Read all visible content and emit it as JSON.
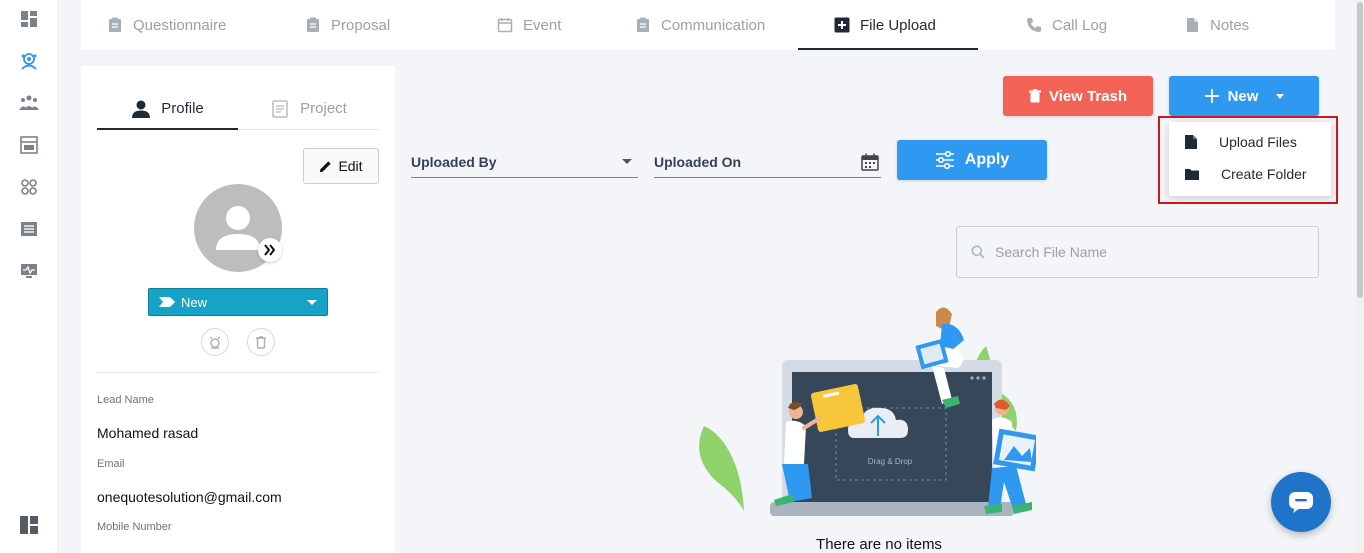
{
  "top_tabs": [
    {
      "label": "Questionnaire",
      "icon": "clipboard-icon",
      "active": false
    },
    {
      "label": "Proposal",
      "icon": "clipboard-icon",
      "active": false
    },
    {
      "label": "Event",
      "icon": "calendar-icon",
      "active": false
    },
    {
      "label": "Communication",
      "icon": "clipboard-icon",
      "active": false
    },
    {
      "label": "File Upload",
      "icon": "plus-square-icon",
      "active": true
    },
    {
      "label": "Call Log",
      "icon": "phone-icon",
      "active": false
    },
    {
      "label": "Notes",
      "icon": "file-icon",
      "active": false
    }
  ],
  "profile": {
    "tabs": [
      {
        "label": "Profile",
        "icon": "person-icon",
        "active": true
      },
      {
        "label": "Project",
        "icon": "project-icon",
        "active": false
      }
    ],
    "edit_label": "Edit",
    "status_value": "New",
    "fields": [
      {
        "label": "Lead Name",
        "value": "Mohamed rasad"
      },
      {
        "label": "Email",
        "value": "onequotesolution@gmail.com"
      },
      {
        "label": "Mobile Number",
        "value": ""
      }
    ]
  },
  "toolbar": {
    "view_trash_label": "View Trash",
    "new_label": "New",
    "apply_label": "Apply"
  },
  "filters": {
    "uploaded_by": "Uploaded By",
    "uploaded_on": "Uploaded On"
  },
  "new_menu": {
    "items": [
      {
        "label": "Upload Files",
        "icon": "file-icon"
      },
      {
        "label": "Create Folder",
        "icon": "folder-icon"
      }
    ]
  },
  "search": {
    "placeholder": "Search File Name"
  },
  "illustration_text": "Drag & Drop",
  "empty_state": "There are no items",
  "colors": {
    "danger": "#f26355",
    "primary": "#2f98f0",
    "status": "#17a2c8",
    "highlight": "#d7141c",
    "chat": "#1f73c9"
  }
}
